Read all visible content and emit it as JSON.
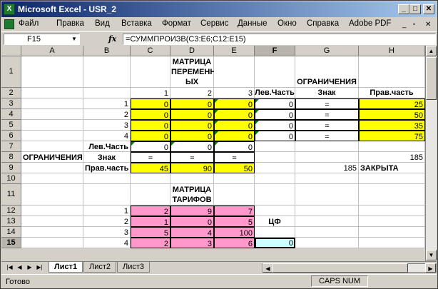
{
  "window": {
    "title": "Microsoft Excel - USR_2",
    "app_icon": "X"
  },
  "menu": [
    "Файл",
    "Правка",
    "Вид",
    "Вставка",
    "Формат",
    "Сервис",
    "Данные",
    "Окно",
    "Справка",
    "Adobe PDF"
  ],
  "formula_bar": {
    "name_box": "F15",
    "fx": "fx",
    "formula": "=СУММПРОИЗВ(C3:E6;C12:E15)"
  },
  "columns": [
    "A",
    "B",
    "C",
    "D",
    "E",
    "F",
    "G",
    "H"
  ],
  "rows": [
    "1",
    "2",
    "3",
    "4",
    "5",
    "6",
    "7",
    "8",
    "9",
    "10",
    "11",
    "12",
    "13",
    "14",
    "15"
  ],
  "cells": {
    "D1": "МАТРИЦА ПЕРЕМЕНН ЫХ",
    "G1": "ОГРАНИЧЕНИЯ",
    "C2": "1",
    "D2": "2",
    "E2": "3",
    "F2": "Лев.Часть",
    "G2": "Знак",
    "H2": "Прав.часть",
    "B3": "1",
    "C3": "0",
    "D3": "0",
    "E3": "0",
    "F3": "0",
    "G3": "=",
    "H3": "25",
    "B4": "2",
    "C4": "0",
    "D4": "0",
    "E4": "0",
    "F4": "0",
    "G4": "=",
    "H4": "50",
    "B5": "3",
    "C5": "0",
    "D5": "0",
    "E5": "0",
    "F5": "0",
    "G5": "=",
    "H5": "35",
    "B6": "4",
    "C6": "0",
    "D6": "0",
    "E6": "0",
    "F6": "0",
    "G6": "=",
    "H6": "75",
    "B7": "Лев.Часть",
    "C7": "0",
    "D7": "0",
    "E7": "0",
    "A8": "ОГРАНИЧЕНИЯ",
    "B8": "Знак",
    "C8": "=",
    "D8": "=",
    "E8": "=",
    "H8": "185",
    "B9": "Прав.часть",
    "C9": "45",
    "D9": "90",
    "E9": "50",
    "G9": "185",
    "H9": "ЗАКРЫТА",
    "D11": "МАТРИЦА ТАРИФОВ",
    "B12": "1",
    "C12": "2",
    "D12": "9",
    "E12": "7",
    "B13": "2",
    "C13": "1",
    "D13": "0",
    "E13": "5",
    "F13": "ЦФ",
    "B14": "3",
    "C14": "5",
    "D14": "4",
    "E14": "100",
    "B15": "4",
    "C15": "2",
    "D15": "3",
    "E15": "6",
    "F15": "0"
  },
  "sheets": [
    "Лист1",
    "Лист2",
    "Лист3"
  ],
  "active_sheet": "Лист1",
  "status": {
    "left": "Готово",
    "right": "CAPS NUM"
  },
  "colors": {
    "title_start": "#0a246a",
    "title_end": "#a6caf0",
    "yellow": "#ffff00",
    "pink": "#ff99cc",
    "cyan": "#ccffff"
  }
}
